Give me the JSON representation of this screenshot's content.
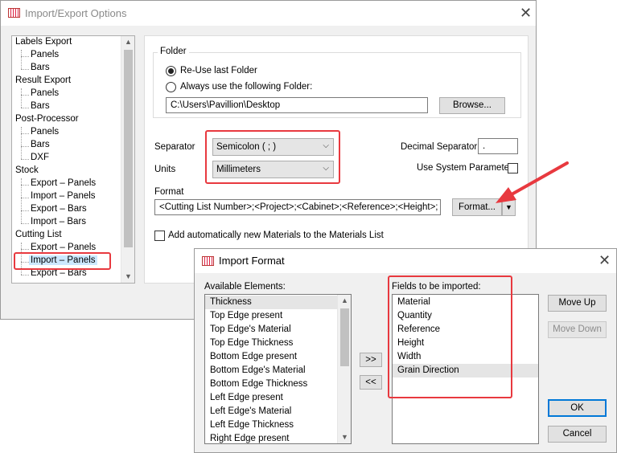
{
  "main_window": {
    "title": "Import/Export Options",
    "tree": [
      {
        "label": "Labels Export",
        "children": [
          "Panels",
          "Bars"
        ]
      },
      {
        "label": "Result Export",
        "children": [
          "Panels",
          "Bars"
        ]
      },
      {
        "label": "Post-Processor",
        "children": [
          "Panels",
          "Bars",
          "DXF"
        ]
      },
      {
        "label": "Stock",
        "children": [
          "Export – Panels",
          "Import – Panels",
          "Export – Bars",
          "Import – Bars"
        ]
      },
      {
        "label": "Cutting List",
        "children": [
          "Export – Panels",
          "Import – Panels",
          "Export – Bars"
        ]
      }
    ],
    "tree_selected": "Import – Panels",
    "folder": {
      "group_label": "Folder",
      "radio_reuse": "Re-Use last Folder",
      "radio_always": "Always use the following Folder:",
      "path_value": "C:\\Users\\Pavillion\\Desktop",
      "browse_label": "Browse..."
    },
    "separator_label": "Separator",
    "separator_value": "Semicolon ( ; )",
    "units_label": "Units",
    "units_value": "Millimeters",
    "decimal_label": "Decimal Separator",
    "decimal_value": ".",
    "system_param_label": "Use System Parameter",
    "format_label": "Format",
    "format_value": "<Cutting List Number>;<Project>;<Cabinet>;<Reference>;<Height>;",
    "format_button": "Format...",
    "add_materials_label": "Add automatically new Materials to the Materials List"
  },
  "dialog": {
    "title": "Import Format",
    "available_label": "Available Elements:",
    "available": [
      "Thickness",
      "Top Edge present",
      "Top Edge's Material",
      "Top Edge Thickness",
      "Bottom Edge present",
      "Bottom Edge's Material",
      "Bottom Edge Thickness",
      "Left Edge present",
      "Left Edge's Material",
      "Left Edge Thickness",
      "Right Edge present"
    ],
    "fields_label": "Fields to be imported:",
    "fields": [
      "Material",
      "Quantity",
      "Reference",
      "Height",
      "Width",
      "Grain Direction"
    ],
    "add_button": ">>",
    "remove_button": "<<",
    "move_up": "Move Up",
    "move_down": "Move Down",
    "ok": "OK",
    "cancel": "Cancel"
  },
  "icons": {
    "close": "close-icon",
    "dropdown": "chevron-down-icon",
    "app": "app-grid-icon"
  },
  "colors": {
    "highlight_red": "#e8393f",
    "selection_blue": "#cce8ff",
    "default_button_border": "#0078d7"
  }
}
